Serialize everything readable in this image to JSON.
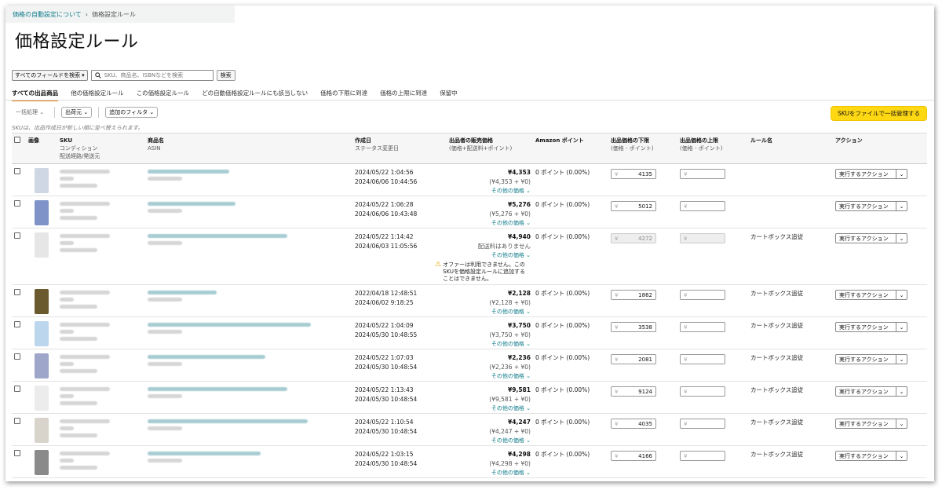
{
  "breadcrumb": {
    "parent": "価格の自動設定について",
    "separator": "›",
    "current": "価格設定ルール"
  },
  "page_title": "価格設定ルール",
  "search": {
    "field_select": "すべてのフィールドを検索",
    "placeholder": "SKU、商品名、ISBNなどを検索",
    "button": "検索"
  },
  "tabs": [
    "すべての出品商品",
    "他の価格設定ルール",
    "この価格設定ルール",
    "どの自動価格設定ルールにも該当しない",
    "価格の下限に到達",
    "価格の上限に到達",
    "保留中"
  ],
  "filters": {
    "bulk": "一括処理",
    "shipper": "出荷元",
    "add_filter": "追加のフィルタ"
  },
  "bulk_manage_button": "SKUをファイルで一括管理する",
  "sort_note": "SKUは、出品作成日が新しい順に並べ替えられます。",
  "headers": {
    "image": "画像",
    "sku": "SKU",
    "sku_sub1": "コンディション",
    "sku_sub2": "配送経路/発送元",
    "name": "商品名",
    "name_sub": "ASIN",
    "created": "作成日",
    "created_sub": "ステータス変更日",
    "price": "出品者の販売価格",
    "price_sub": "(価格+配送料+ポイント)",
    "points": "Amazon ポイント",
    "min": "出品価格の下限",
    "min_sub": "(価格 - ポイント)",
    "max": "出品価格の上限",
    "max_sub": "(価格 - ポイント)",
    "rule": "ルール名",
    "action": "アクション"
  },
  "common": {
    "other_prices": "その他の価格",
    "yen": "¥",
    "action_label": "実行するアクション",
    "rule_name": "カートボックス追従",
    "caret": "⌄"
  },
  "rows": [
    {
      "created": "2024/05/22 1:04:56",
      "changed": "2024/06/06 10:44:56",
      "price": "¥4,353",
      "breakdown": "(¥4,353 + ¥0)",
      "points": "0 ポイント (0.00%)",
      "min": "4135",
      "max": "",
      "rule": "",
      "thumb": "#cfd6e4"
    },
    {
      "created": "2024/05/22 1:06:28",
      "changed": "2024/06/06 10:43:48",
      "price": "¥5,276",
      "breakdown": "(¥5,276 + ¥0)",
      "points": "0 ポイント (0.00%)",
      "min": "5012",
      "max": "",
      "rule": "",
      "thumb": "#7f93c9"
    },
    {
      "created": "2024/05/22 1:14:42",
      "changed": "2024/06/03 11:05:56",
      "price": "¥4,940",
      "breakdown": "配送料はありません",
      "points": "0 ポイント (0.00%)",
      "min": "4272",
      "max": "",
      "rule": "カートボックス追従",
      "thumb": "#e6e6e6",
      "disabled": true,
      "warning": "オファーは利用できません。このSKUを価格設定ルールに追加することはできません。"
    },
    {
      "created": "2022/04/18 12:48:51",
      "changed": "2024/06/02 9:18:25",
      "price": "¥2,128",
      "breakdown": "(¥2,128 + ¥0)",
      "points": "0 ポイント (0.00%)",
      "min": "1862",
      "max": "",
      "rule": "カートボックス追従",
      "thumb": "#6b5a2e"
    },
    {
      "created": "2024/05/22 1:04:09",
      "changed": "2024/05/30 10:48:55",
      "price": "¥3,750",
      "breakdown": "(¥3,750 + ¥0)",
      "points": "0 ポイント (0.00%)",
      "min": "3538",
      "max": "",
      "rule": "カートボックス追従",
      "thumb": "#bcd6ee"
    },
    {
      "created": "2024/05/22 1:07:03",
      "changed": "2024/05/30 10:48:54",
      "price": "¥2,236",
      "breakdown": "(¥2,236 + ¥0)",
      "points": "0 ポイント (0.00%)",
      "min": "2081",
      "max": "",
      "rule": "カートボックス追従",
      "thumb": "#9ea6c9"
    },
    {
      "created": "2024/05/22 1:13:43",
      "changed": "2024/05/30 10:48:54",
      "price": "¥9,581",
      "breakdown": "(¥9,581 + ¥0)",
      "points": "0 ポイント (0.00%)",
      "min": "9124",
      "max": "",
      "rule": "カートボックス追従",
      "thumb": "#ececec"
    },
    {
      "created": "2024/05/22 1:10:54",
      "changed": "2024/05/30 10:48:54",
      "price": "¥4,247",
      "breakdown": "(¥4,247 + ¥0)",
      "points": "0 ポイント (0.00%)",
      "min": "4035",
      "max": "",
      "rule": "カートボックス追従",
      "thumb": "#d8d4cc"
    },
    {
      "created": "2024/05/22 1:03:15",
      "changed": "2024/05/30 10:48:54",
      "price": "¥4,298",
      "breakdown": "(¥4,298 + ¥0)",
      "points": "0 ポイント (0.00%)",
      "min": "4166",
      "max": "",
      "rule": "カートボックス追従",
      "thumb": "#8a8a8a"
    }
  ]
}
